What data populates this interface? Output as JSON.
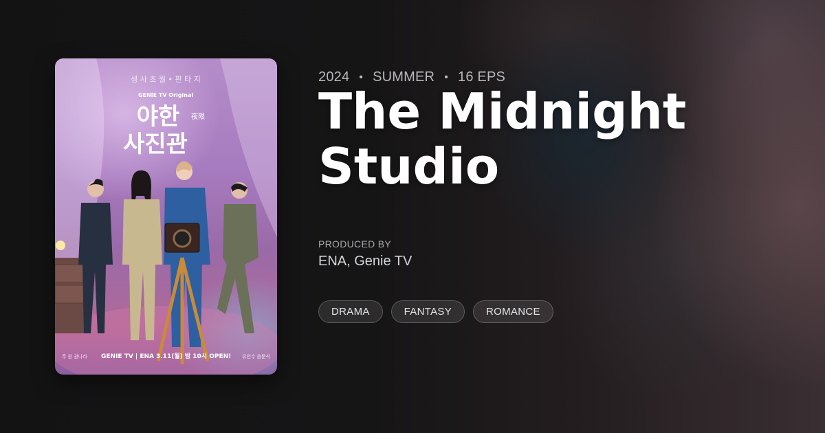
{
  "meta": {
    "year": "2024",
    "season": "SUMMER",
    "episodes": "16 EPS",
    "separator": "•"
  },
  "title": "The Midnight Studio",
  "producer": {
    "label": "PRODUCED BY",
    "value": "ENA, Genie TV"
  },
  "tags": [
    "DRAMA",
    "FANTASY",
    "ROMANCE"
  ],
  "poster": {
    "top_tagline": "생 사 초 월 • 판 타 지",
    "network_badge": "GENIE TV Original",
    "korean_title_line1": "야한",
    "korean_title_hanja": "夜限",
    "korean_title_line2": "사진관",
    "bottom_left_credit": "주 원  권나라",
    "bottom_networks": "GENIE TV | ENA",
    "premiere": "3.11(월) 밤 10시 OPEN!",
    "bottom_right_credit": "유인수  음문석"
  }
}
